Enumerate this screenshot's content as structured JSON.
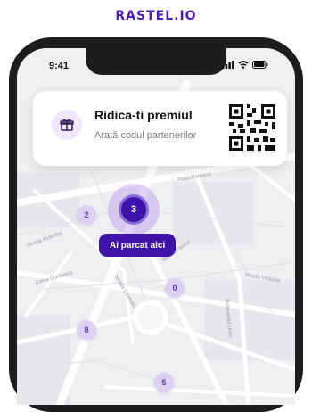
{
  "brand": {
    "logo_text": "RASTEL.IO"
  },
  "status_bar": {
    "time": "9:41"
  },
  "reward_card": {
    "title": "Ridica-ti premiul",
    "subtitle": "Arată codul partenerilor",
    "icon": "gift-icon",
    "qr_icon": "qr-code-icon"
  },
  "map": {
    "clusters": [
      {
        "id": "a",
        "count": "2"
      },
      {
        "id": "b",
        "count": "0"
      },
      {
        "id": "c",
        "count": "8"
      },
      {
        "id": "d",
        "count": "5"
      }
    ],
    "active_cluster": {
      "count": "3"
    },
    "parked_label": "Ai parcat aici",
    "streets": [
      "Strada Nuferilor",
      "Strada Victoriei",
      "Piata Romana",
      "Bulevardul Unirii",
      "Strada Libertatii",
      "Strada Florilor",
      "Calea Dorobanti"
    ]
  },
  "colors": {
    "brand": "#4b1fb4",
    "primary": "#3e14a8",
    "cluster_bg": "#dcd1f1",
    "map_bg": "#eeeff1"
  }
}
